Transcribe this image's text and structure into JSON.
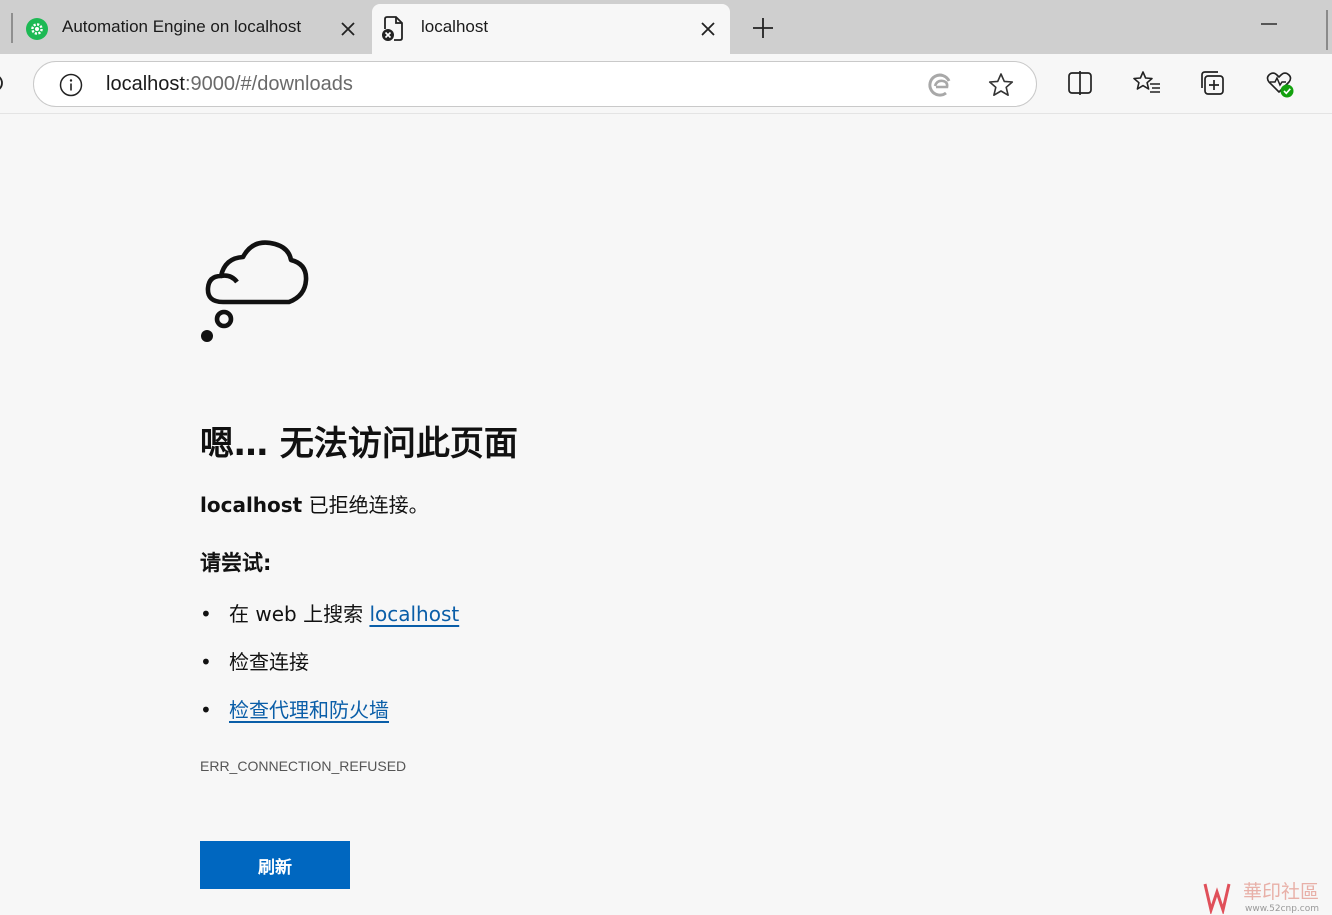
{
  "tabs": [
    {
      "title": "Automation Engine on localhost",
      "state": "inactive",
      "favicon": "gear-icon"
    },
    {
      "title": "localhost",
      "state": "active",
      "favicon": "page-error-icon"
    }
  ],
  "address_bar": {
    "host": "localhost",
    "path": ":9000/#/downloads"
  },
  "page": {
    "headline": "嗯… 无法访问此页面",
    "subline_host": "localhost",
    "subline_text": " 已拒绝连接。",
    "try_label": "请尝试:",
    "suggestions": [
      {
        "prefix": "在 web 上搜索 ",
        "link": "localhost"
      },
      {
        "text": "检查连接"
      },
      {
        "link": "检查代理和防火墙"
      }
    ],
    "bullet": "•",
    "error_code": "ERR_CONNECTION_REFUSED",
    "refresh_label": "刷新"
  },
  "watermark": {
    "text": "華印社區",
    "url": "www.52cnp.com"
  },
  "colors": {
    "accent": "#0067c0",
    "link": "#0a5ea8",
    "favicon_green": "#1db954"
  }
}
